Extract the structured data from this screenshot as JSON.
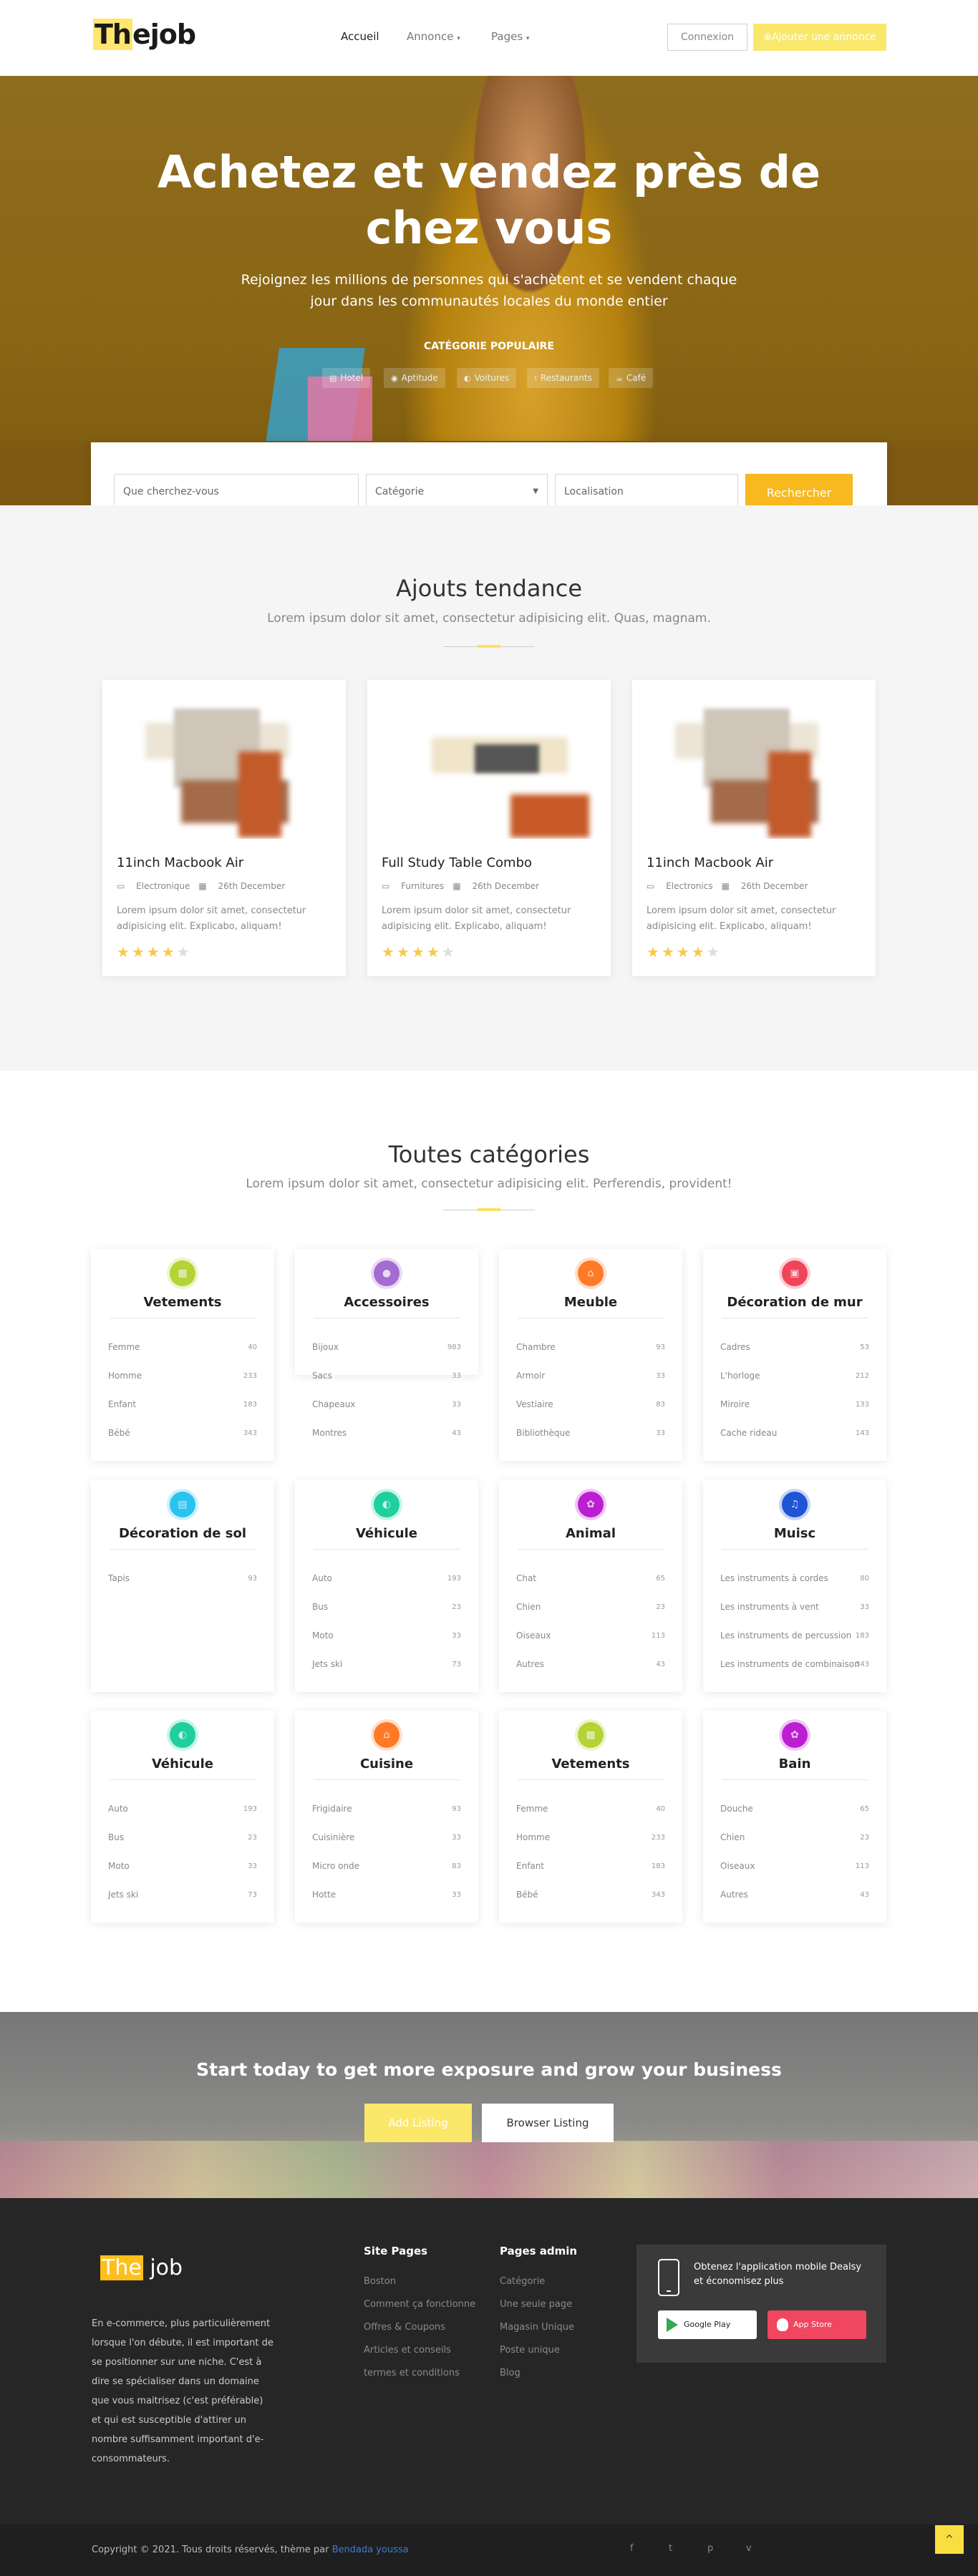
{
  "header": {
    "logo_hl": "Th",
    "logo_rest": "ejob",
    "nav": [
      "Accueil",
      "Annonce",
      "Pages"
    ],
    "login": "Connexion",
    "add": "Ajouter une annonce"
  },
  "hero": {
    "title": "Achetez et vendez près de chez vous",
    "subtitle": "Rejoignez les millions de personnes qui s'achètent et se vendent chaque jour dans les communautés locales du monde entier",
    "popular_label": "CATÉGORIE POPULAIRE",
    "chips": [
      "Hotel",
      "Aptitude",
      "Voitures",
      "Restaurants",
      "Café"
    ]
  },
  "search": {
    "keyword_placeholder": "Que cherchez-vous",
    "category": "Catégorie",
    "location_placeholder": "Localisation",
    "button": "Rechercher"
  },
  "trending": {
    "title": "Ajouts tendance",
    "subtitle": "Lorem ipsum dolor sit amet, consectetur adipisicing elit. Quas, magnam.",
    "cards": [
      {
        "title": "11inch Macbook Air",
        "category": "Electronique",
        "date": "26th December",
        "desc": "Lorem ipsum dolor sit amet, consectetur adipisicing elit. Explicabo, aliquam!",
        "rating": 4
      },
      {
        "title": "Full Study Table Combo",
        "category": "Furnitures",
        "date": "26th December",
        "desc": "Lorem ipsum dolor sit amet, consectetur adipisicing elit. Explicabo, aliquam!",
        "rating": 4
      },
      {
        "title": "11inch Macbook Air",
        "category": "Electronics",
        "date": "26th December",
        "desc": "Lorem ipsum dolor sit amet, consectetur adipisicing elit. Explicabo, aliquam!",
        "rating": 4
      }
    ]
  },
  "categories": {
    "title": "Toutes catégories",
    "subtitle": "Lorem ipsum dolor sit amet, consectetur adipisicing elit. Perferendis, provident!",
    "items": [
      {
        "name": "Vetements",
        "color": "#b5d334",
        "icon": "shirt-icon",
        "rows": [
          [
            "Femme",
            "40"
          ],
          [
            "Homme",
            "233"
          ],
          [
            "Enfant",
            "183"
          ],
          [
            "Bébé",
            "343"
          ]
        ]
      },
      {
        "name": "Accessoires",
        "color": "#a56bd0",
        "icon": "apple-icon",
        "rows": [
          [
            "Bijoux",
            "983"
          ],
          [
            "Sacs",
            "33"
          ],
          [
            "Chapeaux",
            "33"
          ],
          [
            "Montres",
            "43"
          ]
        ]
      },
      {
        "name": "Meuble",
        "color": "#ff7a27",
        "icon": "home-icon",
        "rows": [
          [
            "Chambre",
            "93"
          ],
          [
            "Armoir",
            "33"
          ],
          [
            "Vestiaire",
            "83"
          ],
          [
            "Bibliothèque",
            "33"
          ]
        ]
      },
      {
        "name": "Décoration de mur",
        "color": "#f0455a",
        "icon": "picture-icon",
        "rows": [
          [
            "Cadres",
            "53"
          ],
          [
            "L'horloge",
            "212"
          ],
          [
            "Miroire",
            "133"
          ],
          [
            "Cache rideau",
            "143"
          ]
        ]
      },
      {
        "name": "Décoration de sol",
        "color": "#2ac3ef",
        "icon": "briefcase-icon",
        "rows": [
          [
            "Tapis",
            "93"
          ]
        ]
      },
      {
        "name": "Véhicule",
        "color": "#1fcf9f",
        "icon": "car-icon",
        "rows": [
          [
            "Auto",
            "193"
          ],
          [
            "Bus",
            "23"
          ],
          [
            "Moto",
            "33"
          ],
          [
            "Jets ski",
            "73"
          ]
        ]
      },
      {
        "name": "Animal",
        "color": "#bc1fd2",
        "icon": "paw-icon",
        "rows": [
          [
            "Chat",
            "65"
          ],
          [
            "Chien",
            "23"
          ],
          [
            "Oiseaux",
            "113"
          ],
          [
            "Autres",
            "43"
          ]
        ]
      },
      {
        "name": "Muisc",
        "color": "#1f55d6",
        "icon": "music-icon",
        "rows": [
          [
            "Les instruments à cordes",
            "80"
          ],
          [
            "Les instruments à vent",
            "33"
          ],
          [
            "Les instruments de percussion",
            "183"
          ],
          [
            "Les instruments de combinaison",
            "343"
          ]
        ]
      },
      {
        "name": "Véhicule",
        "color": "#1fcf9f",
        "icon": "car-icon",
        "rows": [
          [
            "Auto",
            "193"
          ],
          [
            "Bus",
            "23"
          ],
          [
            "Moto",
            "33"
          ],
          [
            "Jets ski",
            "73"
          ]
        ]
      },
      {
        "name": "Cuisine",
        "color": "#ff7a27",
        "icon": "home-icon",
        "rows": [
          [
            "Frigidaire",
            "93"
          ],
          [
            "Cuisinière",
            "33"
          ],
          [
            "Micro onde",
            "83"
          ],
          [
            "Hotte",
            "33"
          ]
        ]
      },
      {
        "name": "Vetements",
        "color": "#b5d334",
        "icon": "shirt-icon",
        "rows": [
          [
            "Femme",
            "40"
          ],
          [
            "Homme",
            "233"
          ],
          [
            "Enfant",
            "183"
          ],
          [
            "Bébé",
            "343"
          ]
        ]
      },
      {
        "name": "Bain",
        "color": "#bc1fd2",
        "icon": "paw-icon",
        "rows": [
          [
            "Douche",
            "65"
          ],
          [
            "Chien",
            "23"
          ],
          [
            "Oiseaux",
            "113"
          ],
          [
            "Autres",
            "43"
          ]
        ]
      }
    ]
  },
  "cta": {
    "title": "Start today to get more exposure and grow your business",
    "add": "Add Listing",
    "browse": "Browser Listing"
  },
  "footer": {
    "logo_hl": "The",
    "logo_rest": " job",
    "about": "En e-commerce, plus particulièrement lorsque l'on débute, il est important de se positionner sur une niche. C'est à dire se spécialiser dans un domaine que vous maitrisez (c'est préférable) et qui est susceptible d'attirer un nombre suffisamment important d'e-consommateurs.",
    "site_title": "Site Pages",
    "site_links": [
      "Boston",
      "Comment ça fonctionne",
      "Offres & Coupons",
      "Articles et conseils",
      "termes et conditions"
    ],
    "admin_title": "Pages admin",
    "admin_links": [
      "Catégorie",
      "Une seule page",
      "Magasin Unique",
      "Poste unique",
      "Blog"
    ],
    "app_text": "Obtenez l'application mobile Dealsy et économisez plus",
    "google": "Google Play",
    "apple": "App Store",
    "copyright_prefix": "Copyright © 2021. Tous droits réservés, thème par ",
    "copyright_author": "Bendada youssa",
    "social": [
      "f",
      "t",
      "p",
      "v"
    ],
    "top_label": "^"
  }
}
